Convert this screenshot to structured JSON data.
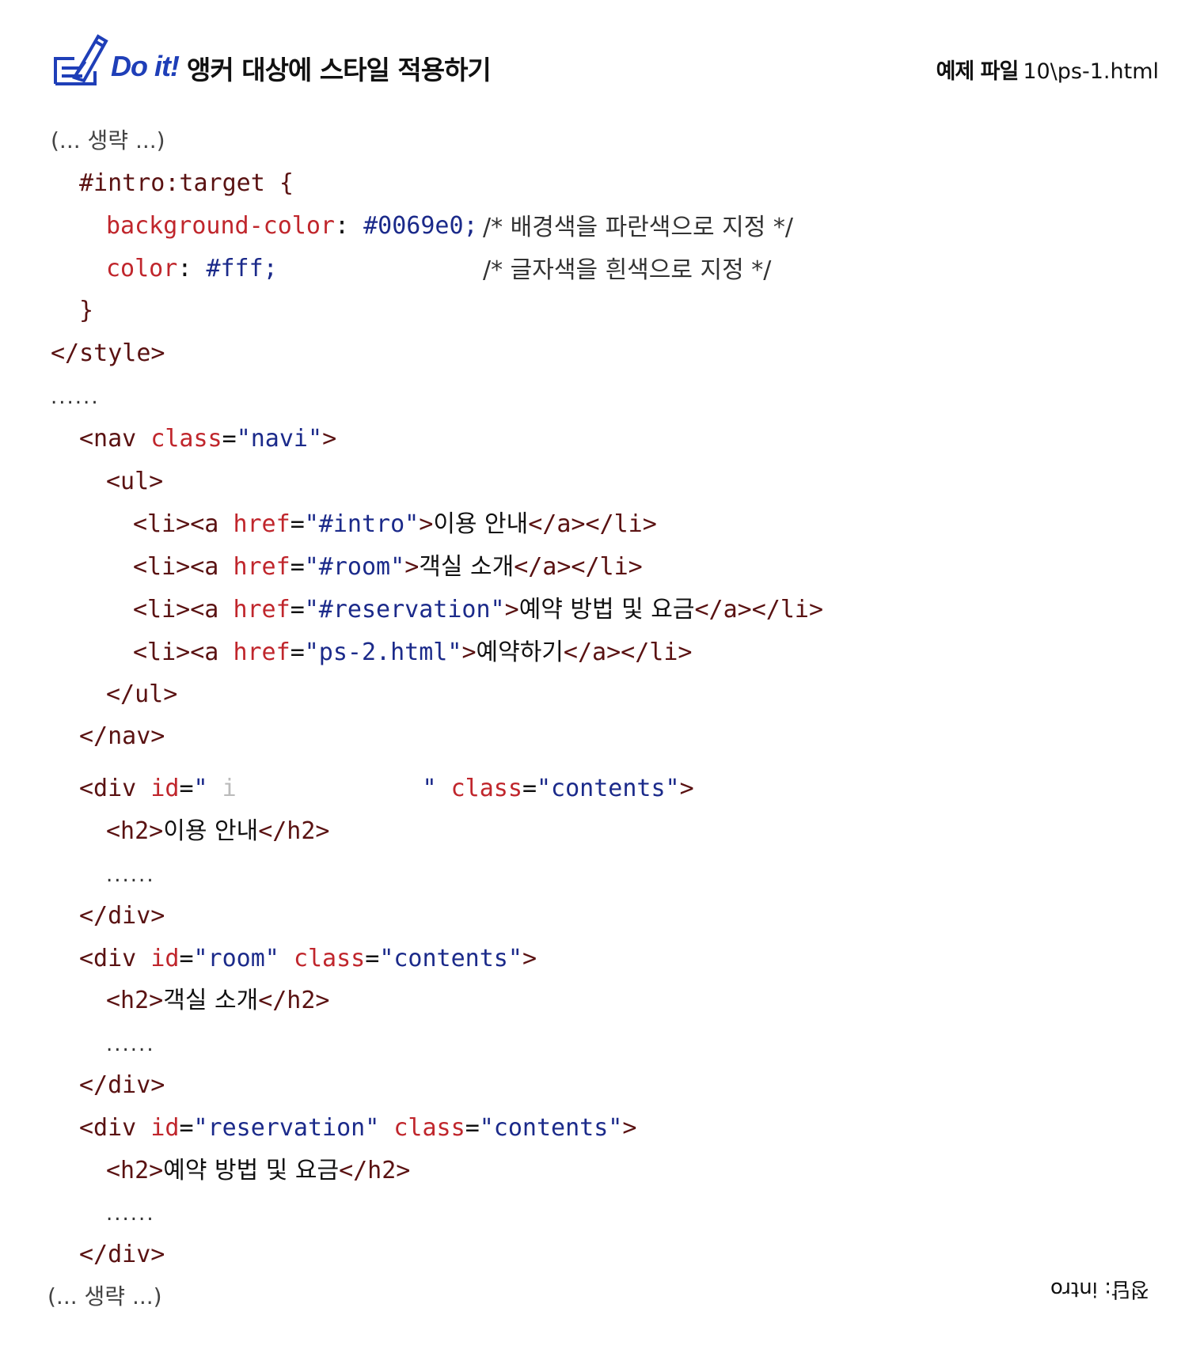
{
  "header": {
    "doit_label": "Do it!",
    "title": "앵커 대상에 스타일 적용하기",
    "example_label": "예제 파일",
    "example_file": "10\\ps-1.html"
  },
  "omitted_top": "(... 생략 ...)",
  "omitted_bottom": "(... 생략 ...)",
  "ellipsis": "......",
  "answer_rotated": "정답: intro",
  "code": {
    "selector": "#intro:target {",
    "prop1": "background-color",
    "val1": "#0069e0;",
    "comment1": "/* 배경색을 파란색으로 지정 */",
    "prop2": "color",
    "val2": "#fff;",
    "comment2": "/* 글자색을 흰색으로 지정 */",
    "close_brace": "}",
    "style_close": "</style>",
    "nav_open_tag": "<nav",
    "nav_class_attr": "class",
    "nav_class_val": "\"navi\"",
    "ul_open": "<ul>",
    "li1_href": "\"#intro\"",
    "li1_text": "이용 안내",
    "li2_href": "\"#room\"",
    "li2_text": "객실 소개",
    "li3_href": "\"#reservation\"",
    "li3_text": "예약 방법 및 요금",
    "li4_href": "\"ps-2.html\"",
    "li4_text": "예약하기",
    "ul_close": "</ul>",
    "nav_close": "</nav>",
    "div1_blank_char": "i",
    "div_class_val": "\"contents\"",
    "h2_1": "이용 안내",
    "div_close": "</div>",
    "div2_id": "\"room\"",
    "h2_2": "객실 소개",
    "div3_id": "\"reservation\"",
    "h2_3": "예약 방법 및 요금"
  },
  "colors": {
    "tag": "#5a1212",
    "attr": "#c0262c",
    "value": "#1b2a8a",
    "brand": "#1f3fb8"
  }
}
